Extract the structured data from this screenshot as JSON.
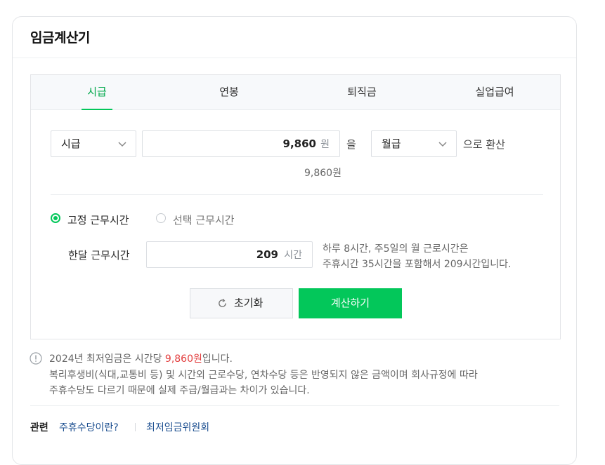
{
  "title": "임금계산기",
  "tabs": [
    {
      "label": "시급",
      "active": true
    },
    {
      "label": "연봉",
      "active": false
    },
    {
      "label": "퇴직금",
      "active": false
    },
    {
      "label": "실업급여",
      "active": false
    }
  ],
  "converter": {
    "from_select": "시급",
    "amount_value": "9,860",
    "amount_unit": "원",
    "particle": "을",
    "to_select": "월급",
    "suffix": "으로 환산",
    "converted_display": "9,860원"
  },
  "work_hours": {
    "radio_fixed": "고정 근무시간",
    "radio_custom": "선택 근무시간",
    "selected": "fixed",
    "label": "한달 근무시간",
    "value": "209",
    "unit": "시간",
    "help_line1": "하루 8시간, 주5일의 월 근로시간은",
    "help_line2": "주휴시간 35시간을 포함해서 209시간입니다."
  },
  "buttons": {
    "reset": "초기화",
    "calculate": "계산하기"
  },
  "notice": {
    "line1_prefix": "2024년 최저임금은 시간당 ",
    "line1_highlight": "9,860원",
    "line1_suffix": "입니다.",
    "line2": "복리후생비(식대,교통비 등) 및 시간외 근로수당, 연차수당 등은 반영되지 않은 금액이며 회사규정에 따라",
    "line3": "주휴수당도 다르기 때문에 실제 주급/월급과는 차이가 있습니다."
  },
  "related": {
    "label": "관련",
    "links": [
      "주휴수당이란?",
      "최저임금위원회"
    ]
  },
  "colors": {
    "accent": "#03c75a",
    "highlight": "#e23c3c",
    "link": "#1a4d8f"
  }
}
